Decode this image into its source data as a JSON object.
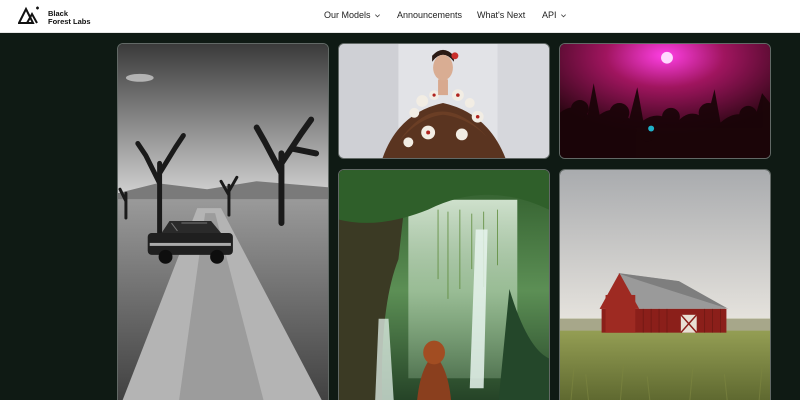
{
  "brand": {
    "name_line1": "Black",
    "name_line2": "Forest Labs",
    "icon": "bfl-logo-icon"
  },
  "nav": {
    "items": [
      {
        "label": "Our Models",
        "has_dropdown": true
      },
      {
        "label": "Announcements",
        "has_dropdown": false
      },
      {
        "label": "What's Next",
        "has_dropdown": false
      },
      {
        "label": "API",
        "has_dropdown": true
      }
    ]
  },
  "gallery": {
    "images": [
      {
        "subject": "desert-road-car-image"
      },
      {
        "subject": "fashion-model-image"
      },
      {
        "subject": "concert-crowd-image"
      },
      {
        "subject": "forest-waterfall-image"
      },
      {
        "subject": "red-barn-image"
      }
    ]
  },
  "colors": {
    "page_bg": "#0f1a14",
    "nav_bg": "#ffffff",
    "nav_text": "#222222"
  }
}
